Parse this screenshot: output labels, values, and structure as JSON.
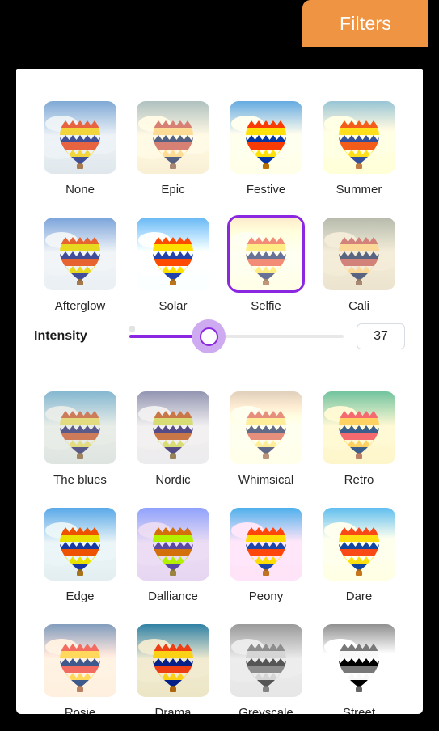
{
  "tab": {
    "label": "Filters",
    "color": "#ef9443"
  },
  "panel": {
    "accent": "#8b27e0",
    "selected_filter": "Selfie"
  },
  "intensity": {
    "label": "Intensity",
    "value": "37",
    "min": "0",
    "max": "100"
  },
  "rows": [
    {
      "cells": [
        {
          "label": "None",
          "sky": "#7fa9d6",
          "cloud": "#eef3f7",
          "haze": "#dfe7ec",
          "sat": "1",
          "con": "1",
          "sep": "0",
          "hue": "0",
          "bright": "1",
          "selected": false
        },
        {
          "label": "Epic",
          "sky": "#9fb7c4",
          "cloud": "#edeee2",
          "haze": "#e3e3cf",
          "sat": "0.72",
          "con": "0.95",
          "sep": "0.18",
          "hue": "-8",
          "bright": "1.02",
          "selected": false
        },
        {
          "label": "Festive",
          "sky": "#5ba3dd",
          "cloud": "#fbf6e6",
          "haze": "#fcf6df",
          "sat": "1.35",
          "con": "1.1",
          "sep": "0.05",
          "hue": "0",
          "bright": "1.04",
          "selected": false
        },
        {
          "label": "Summer",
          "sky": "#86b6d2",
          "cloud": "#fdf3d6",
          "haze": "#faeec8",
          "sat": "1.2",
          "con": "1.02",
          "sep": "0.12",
          "hue": "-5",
          "bright": "1.06",
          "selected": false
        }
      ]
    },
    {
      "cells": [
        {
          "label": "Afterglow",
          "sky": "#76a5d8",
          "cloud": "#f2f5f8",
          "haze": "#e9eff4",
          "sat": "1.05",
          "con": "1.0",
          "sep": "0",
          "hue": "4",
          "bright": "1.0",
          "selected": false
        },
        {
          "label": "Solar",
          "sky": "#63b0e8",
          "cloud": "#f4f9fc",
          "haze": "#eef6fb",
          "sat": "1.3",
          "con": "1.05",
          "sep": "0",
          "hue": "0",
          "bright": "1.05",
          "selected": false
        },
        {
          "label": "Selfie",
          "sky": "#cfcdb6",
          "cloud": "#fbf4dc",
          "haze": "#f9efcf",
          "sat": "0.95",
          "con": "0.9",
          "sep": "0.25",
          "hue": "-6",
          "bright": "1.1",
          "selected": true
        },
        {
          "label": "Cali",
          "sky": "#a8b5b0",
          "cloud": "#e3e5da",
          "haze": "#dadbcd",
          "sat": "0.7",
          "con": "0.92",
          "sep": "0.2",
          "hue": "-10",
          "bright": "1.0",
          "selected": false
        }
      ]
    },
    {
      "cells": [
        {
          "label": "The blues",
          "sky": "#74b8cf",
          "cloud": "#e0e9e9",
          "haze": "#d5e0e1",
          "sat": "0.78",
          "con": "0.95",
          "sep": "0.1",
          "hue": "8",
          "bright": "1.0",
          "selected": false
        },
        {
          "label": "Nordic",
          "sky": "#8897b5",
          "cloud": "#eceff4",
          "haze": "#e6eaf0",
          "sat": "0.8",
          "con": "1.0",
          "sep": "0.08",
          "hue": "14",
          "bright": "0.99",
          "selected": false
        },
        {
          "label": "Whimsical",
          "sky": "#bdb5ae",
          "cloud": "#faeedd",
          "haze": "#fbecd5",
          "sat": "0.82",
          "con": "0.93",
          "sep": "0.3",
          "hue": "-8",
          "bright": "1.08",
          "selected": false
        },
        {
          "label": "Retro",
          "sky": "#5fbcb2",
          "cloud": "#e7f0cd",
          "haze": "#e1edc2",
          "sat": "1.0",
          "con": "0.98",
          "sep": "0.12",
          "hue": "-18",
          "bright": "1.03",
          "selected": false
        }
      ]
    },
    {
      "cells": [
        {
          "label": "Edge",
          "sky": "#4fa8dd",
          "cloud": "#e7f1f2",
          "haze": "#deeaeb",
          "sat": "1.15",
          "con": "1.08",
          "sep": "0",
          "hue": "6",
          "bright": "1.02",
          "selected": false
        },
        {
          "label": "Dalliance",
          "sky": "#6fa7e8",
          "cloud": "#ded8ef",
          "haze": "#d8d2ec",
          "sat": "1.1",
          "con": "1.0",
          "sep": "0",
          "hue": "20",
          "bright": "1.03",
          "selected": false
        },
        {
          "label": "Peony",
          "sky": "#4fa5e6",
          "cloud": "#fbdcec",
          "haze": "#fbd8ea",
          "sat": "1.3",
          "con": "1.05",
          "sep": "0",
          "hue": "-4",
          "bright": "1.05",
          "selected": false
        },
        {
          "label": "Dare",
          "sky": "#59aeec",
          "cloud": "#fbf5de",
          "haze": "#faf2d4",
          "sat": "1.3",
          "con": "1.06",
          "sep": "0.06",
          "hue": "-6",
          "bright": "1.07",
          "selected": false
        }
      ]
    },
    {
      "cells": [
        {
          "label": "Rosie",
          "sky": "#7b8fc4",
          "cloud": "#fbe3d6",
          "haze": "#fbe0d2",
          "sat": "1.0",
          "con": "1.0",
          "sep": "0.15",
          "hue": "-12",
          "bright": "1.04",
          "selected": false
        },
        {
          "label": "Drama",
          "sky": "#2a82b5",
          "cloud": "#eeecd4",
          "haze": "#e8e7c9",
          "sat": "1.15",
          "con": "1.15",
          "sep": "0.1",
          "hue": "-4",
          "bright": "0.98",
          "selected": false
        },
        {
          "label": "Greyscale",
          "sky": "#9a9a9a",
          "cloud": "#ededed",
          "haze": "#e6e6e6",
          "sat": "0",
          "con": "1.0",
          "sep": "0",
          "hue": "0",
          "bright": "1.0",
          "selected": false
        },
        {
          "label": "Street",
          "sky": "#8c8c8c",
          "cloud": "#f2f2f2",
          "haze": "#ececec",
          "sat": "0",
          "con": "1.3",
          "sep": "0",
          "hue": "0",
          "bright": "1.0",
          "selected": false
        }
      ]
    }
  ]
}
